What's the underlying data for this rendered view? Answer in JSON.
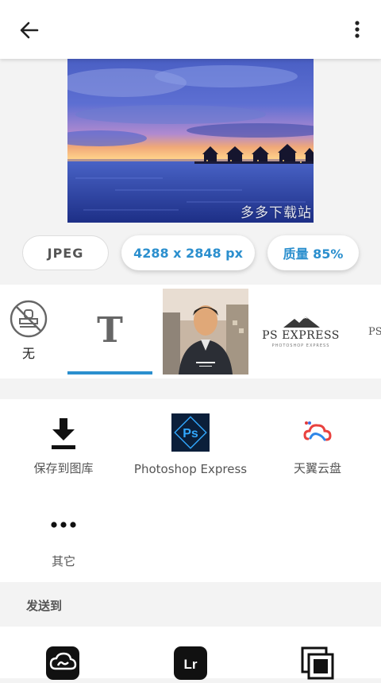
{
  "topbar": {
    "back_icon": "arrow-left-icon",
    "more_icon": "more-vertical-icon"
  },
  "preview": {
    "watermark_text": "多多下载站"
  },
  "export_options": {
    "format": "JPEG",
    "dimensions": "4288 x 2848 px",
    "quality": "质量 85%"
  },
  "watermarks": {
    "none_label": "无",
    "text_glyph": "T",
    "logo_text": "PS EXPRESS",
    "logo_subtext": "PHOTOSHOP EXPRESS",
    "partial_text": "PS",
    "selected": "text"
  },
  "share_targets": [
    {
      "label": "保存到图库",
      "icon": "download-icon"
    },
    {
      "label": "Photoshop Express",
      "icon": "photoshop-express-icon"
    },
    {
      "label": "天翼云盘",
      "icon": "cloud-drive-icon"
    },
    {
      "label": "其它",
      "icon": "more-horizontal-icon"
    }
  ],
  "send_to": {
    "title": "发送到",
    "apps": [
      "creative-cloud-icon",
      "lightroom-icon",
      "frame-stack-icon"
    ],
    "lr_text": "Lr"
  },
  "colors": {
    "accent": "#2b8fce",
    "background": "#f3f3f3"
  }
}
